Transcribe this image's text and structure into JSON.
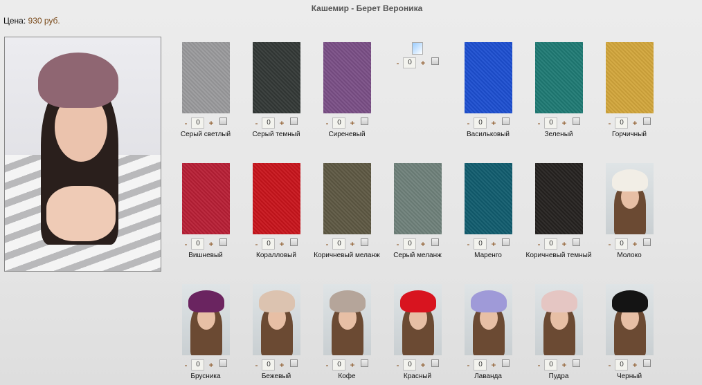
{
  "title": "Кашемир - Берет Вероника",
  "price_label": "Цена:",
  "price_value": "930 руб.",
  "controls": {
    "minus": "-",
    "plus": "+"
  },
  "items": [
    {
      "label": "Серый светлый",
      "color": "#9a9a9c",
      "type": "swatch",
      "qty": "0"
    },
    {
      "label": "Серый темный",
      "color": "#333836",
      "type": "swatch",
      "qty": "0"
    },
    {
      "label": "Сиреневый",
      "color": "#7a4f86",
      "type": "swatch",
      "qty": "0"
    },
    {
      "label": "",
      "color": "",
      "type": "broken",
      "qty": "0"
    },
    {
      "label": "Васильковый",
      "color": "#1d4fd0",
      "type": "swatch",
      "qty": "0"
    },
    {
      "label": "Зеленый",
      "color": "#1f7a74",
      "type": "swatch",
      "qty": "0"
    },
    {
      "label": "Горчичный",
      "color": "#d2a63b",
      "type": "swatch",
      "qty": "0"
    },
    {
      "label": "Вишневый",
      "color": "#b81f35",
      "type": "swatch",
      "qty": "0"
    },
    {
      "label": "Коралловый",
      "color": "#c8141c",
      "type": "swatch",
      "qty": "0"
    },
    {
      "label": "Коричневый меланж",
      "color": "#5e5843",
      "type": "swatch",
      "qty": "0"
    },
    {
      "label": "Серый меланж",
      "color": "#6f817a",
      "type": "swatch",
      "qty": "0"
    },
    {
      "label": "Маренго",
      "color": "#115c6e",
      "type": "swatch",
      "qty": "0"
    },
    {
      "label": "Коричневый темный",
      "color": "#252220",
      "type": "swatch",
      "qty": "0"
    },
    {
      "label": "Молоко",
      "color": "#f2eee6",
      "type": "photo",
      "qty": "0"
    },
    {
      "label": "Брусника",
      "color": "#6a2460",
      "type": "photo",
      "qty": "0"
    },
    {
      "label": "Бежевый",
      "color": "#dcc3b0",
      "type": "photo",
      "qty": "0"
    },
    {
      "label": "Кофе",
      "color": "#b5a59a",
      "type": "photo",
      "qty": "0"
    },
    {
      "label": "Красный",
      "color": "#d8141f",
      "type": "photo",
      "qty": "0"
    },
    {
      "label": "Лаванда",
      "color": "#9f9ad8",
      "type": "photo",
      "qty": "0"
    },
    {
      "label": "Пудра",
      "color": "#e5c6c3",
      "type": "photo",
      "qty": "0"
    },
    {
      "label": "Черный",
      "color": "#141414",
      "type": "photo",
      "qty": "0"
    }
  ]
}
